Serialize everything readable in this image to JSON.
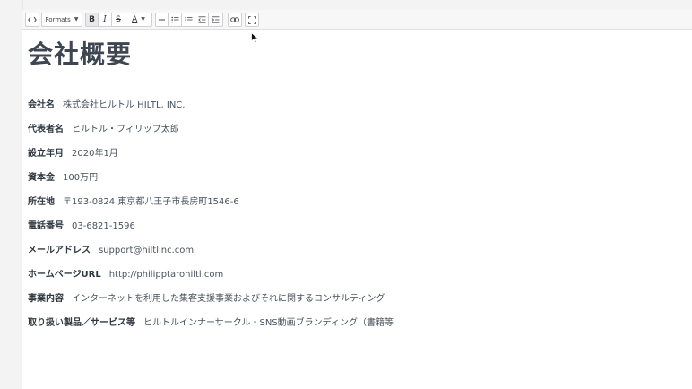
{
  "toolbar": {
    "source_icon": "code-view-icon",
    "formats_label": "Formats",
    "bold_label": "B",
    "italic_label": "I",
    "strike_label": "S",
    "color_label": "A",
    "buttons": [
      "code-view-icon",
      "bold-icon",
      "italic-icon",
      "strikethrough-icon",
      "font-color-icon",
      "horizontal-rule-icon",
      "bullet-list-icon",
      "numbered-list-icon",
      "outdent-icon",
      "indent-icon",
      "link-icon",
      "fullscreen-icon"
    ]
  },
  "page": {
    "title": "会社概要",
    "rows": [
      {
        "label": "会社名",
        "value": "株式会社ヒルトル HILTL, INC."
      },
      {
        "label": "代表者名",
        "value": "ヒルトル・フィリップ太郎"
      },
      {
        "label": "設立年月",
        "value": "2020年1月"
      },
      {
        "label": "資本金",
        "value": "100万円"
      },
      {
        "label": "所在地",
        "value": "〒193-0824 東京都八王子市長房町1546-6"
      },
      {
        "label": "電話番号",
        "value": "03-6821-1596"
      },
      {
        "label": "メールアドレス",
        "value": "support@hiltlinc.com"
      },
      {
        "label": "ホームページURL",
        "value": "http://philipptarohiltl.com"
      },
      {
        "label": "事業内容",
        "value": "インターネットを利用した集客支援事業およびそれに関するコンサルティング"
      },
      {
        "label": "取り扱い製品／サービス等",
        "value": "ヒルトルインナーサークル・SNS動画ブランディング（書籍等"
      }
    ]
  },
  "colors": {
    "text": "#3d4651",
    "toolbar_bg": "#f7f7f8",
    "background": "#f3f3f4"
  }
}
